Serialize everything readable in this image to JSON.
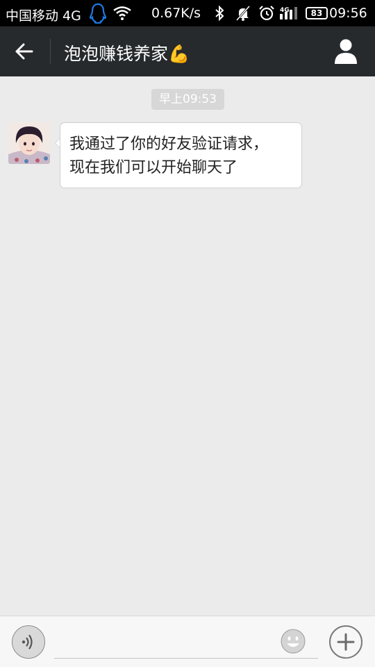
{
  "status_bar": {
    "carrier": "中国移动 4G",
    "net_speed": "0.67K/s",
    "signal_label": "4G",
    "battery": "83",
    "time": "09:56"
  },
  "header": {
    "title": "泡泡赚钱养家",
    "title_emoji": "💪"
  },
  "chat": {
    "timestamp": "早上09:53",
    "messages": [
      {
        "sender": "contact",
        "line1": "我通过了你的好友验证请求，",
        "line2": "现在我们可以开始聊天了"
      }
    ]
  },
  "input_bar": {
    "text_value": ""
  },
  "colors": {
    "header_bg": "#262a2d",
    "chat_bg": "#ebebeb",
    "bubble_bg": "#ffffff",
    "qq_icon": "#1e7ae6"
  }
}
